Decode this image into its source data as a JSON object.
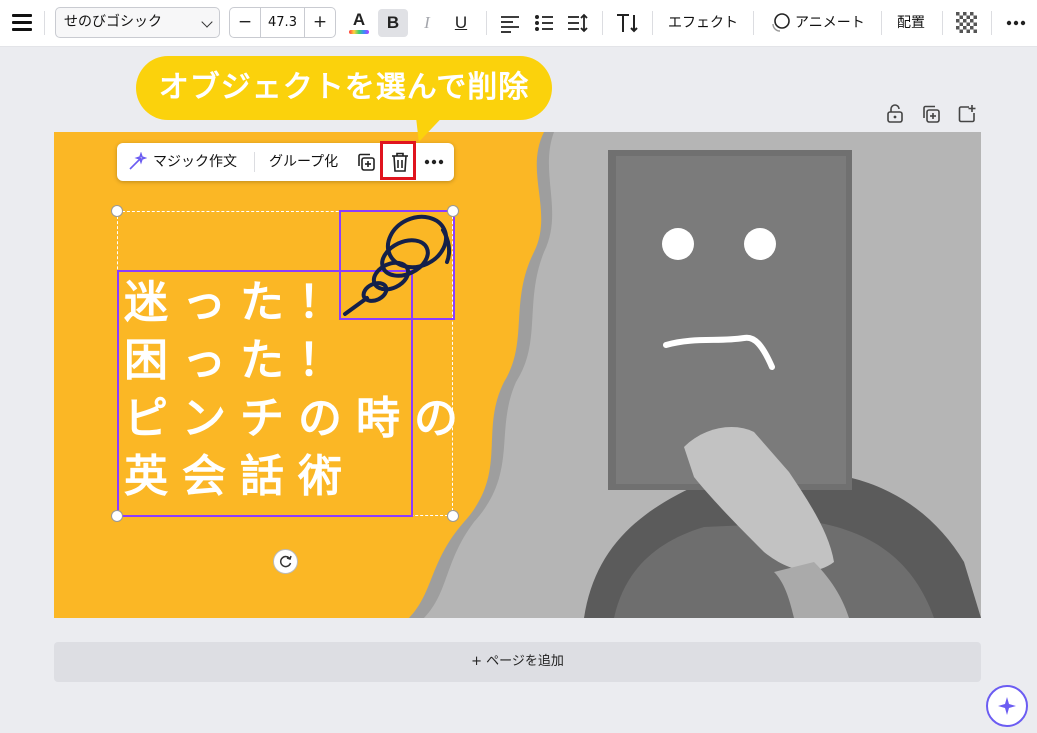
{
  "toolbar": {
    "font_name": "せのびゴシック",
    "font_size": "47.3",
    "minus": "−",
    "plus": "+",
    "text_color_letter": "A",
    "bold_letter": "B",
    "italic_letter": "I",
    "underline_letter": "U",
    "effects_label": "エフェクト",
    "animate_label": "アニメート",
    "position_label": "配置",
    "more_icon": "ellipsis-icon"
  },
  "callout": {
    "text": "オブジェクトを選んで削除",
    "color": "#fbd20c"
  },
  "context_menu": {
    "magic_write_label": "マジック作文",
    "group_label": "グループ化",
    "duplicate_icon": "duplicate-icon",
    "delete_icon": "trash-icon",
    "more_icon": "ellipsis-icon"
  },
  "design": {
    "background_color": "#fbb725",
    "headline_lines": [
      "迷った！",
      "困った！",
      "ピンチの時の",
      "英会話術"
    ],
    "selection_color": "#8b3dff"
  },
  "page": {
    "add_page_label": "+ ページを追加"
  },
  "highlight_color": "#e0141e"
}
